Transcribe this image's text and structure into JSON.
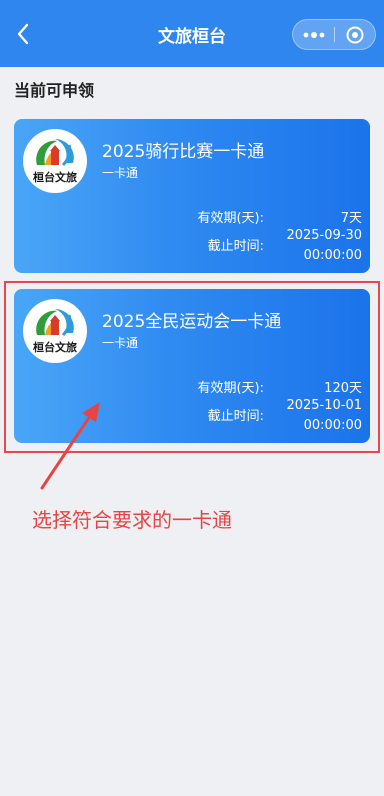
{
  "navbar": {
    "title": "文旅桓台",
    "back_icon": "chevron-left-icon",
    "more_icon": "more-dots-icon",
    "close_icon": "target-close-icon",
    "bg_color": "#2f86ee"
  },
  "section": {
    "title": "当前可申领"
  },
  "cards": [
    {
      "name": "2025骑行比赛一卡通",
      "subtitle": "一卡通",
      "logo_text": "桓台文旅",
      "validity_label": "有效期(天):",
      "validity_value": "7天",
      "deadline_label": "截止时间:",
      "deadline_date": "2025-09-30",
      "deadline_time": "00:00:00"
    },
    {
      "name": "2025全民运动会一卡通",
      "subtitle": "一卡通",
      "logo_text": "桓台文旅",
      "validity_label": "有效期(天):",
      "validity_value": "120天",
      "deadline_label": "截止时间:",
      "deadline_date": "2025-10-01",
      "deadline_time": "00:00:00"
    }
  ],
  "annotation": {
    "text": "选择符合要求的一卡通",
    "color": "#e84444"
  }
}
